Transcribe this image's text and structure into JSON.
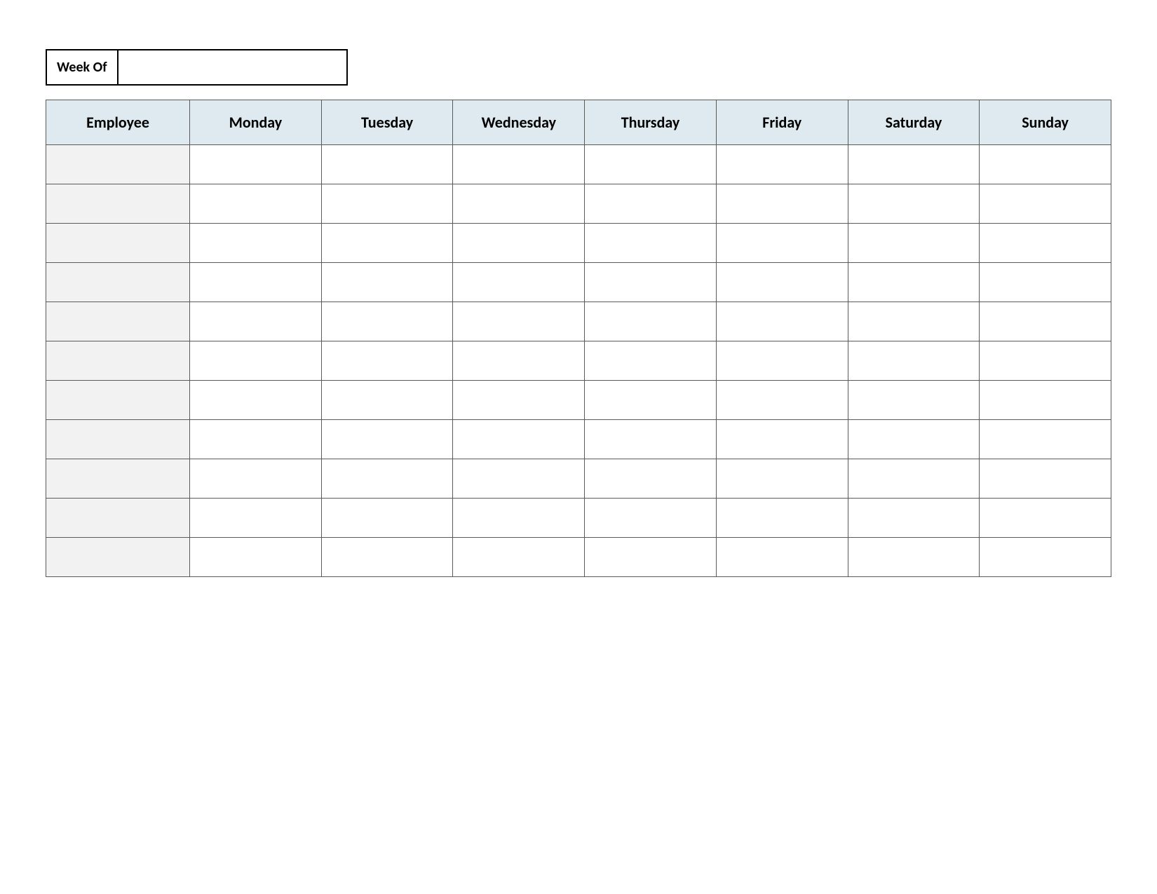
{
  "weekOf": {
    "label": "Week Of",
    "value": ""
  },
  "headers": {
    "employee": "Employee",
    "days": [
      "Monday",
      "Tuesday",
      "Wednesday",
      "Thursday",
      "Friday",
      "Saturday",
      "Sunday"
    ]
  },
  "rows": [
    {
      "employee": "",
      "cells": [
        "",
        "",
        "",
        "",
        "",
        "",
        ""
      ]
    },
    {
      "employee": "",
      "cells": [
        "",
        "",
        "",
        "",
        "",
        "",
        ""
      ]
    },
    {
      "employee": "",
      "cells": [
        "",
        "",
        "",
        "",
        "",
        "",
        ""
      ]
    },
    {
      "employee": "",
      "cells": [
        "",
        "",
        "",
        "",
        "",
        "",
        ""
      ]
    },
    {
      "employee": "",
      "cells": [
        "",
        "",
        "",
        "",
        "",
        "",
        ""
      ]
    },
    {
      "employee": "",
      "cells": [
        "",
        "",
        "",
        "",
        "",
        "",
        ""
      ]
    },
    {
      "employee": "",
      "cells": [
        "",
        "",
        "",
        "",
        "",
        "",
        ""
      ]
    },
    {
      "employee": "",
      "cells": [
        "",
        "",
        "",
        "",
        "",
        "",
        ""
      ]
    },
    {
      "employee": "",
      "cells": [
        "",
        "",
        "",
        "",
        "",
        "",
        ""
      ]
    },
    {
      "employee": "",
      "cells": [
        "",
        "",
        "",
        "",
        "",
        "",
        ""
      ]
    },
    {
      "employee": "",
      "cells": [
        "",
        "",
        "",
        "",
        "",
        "",
        ""
      ]
    }
  ]
}
